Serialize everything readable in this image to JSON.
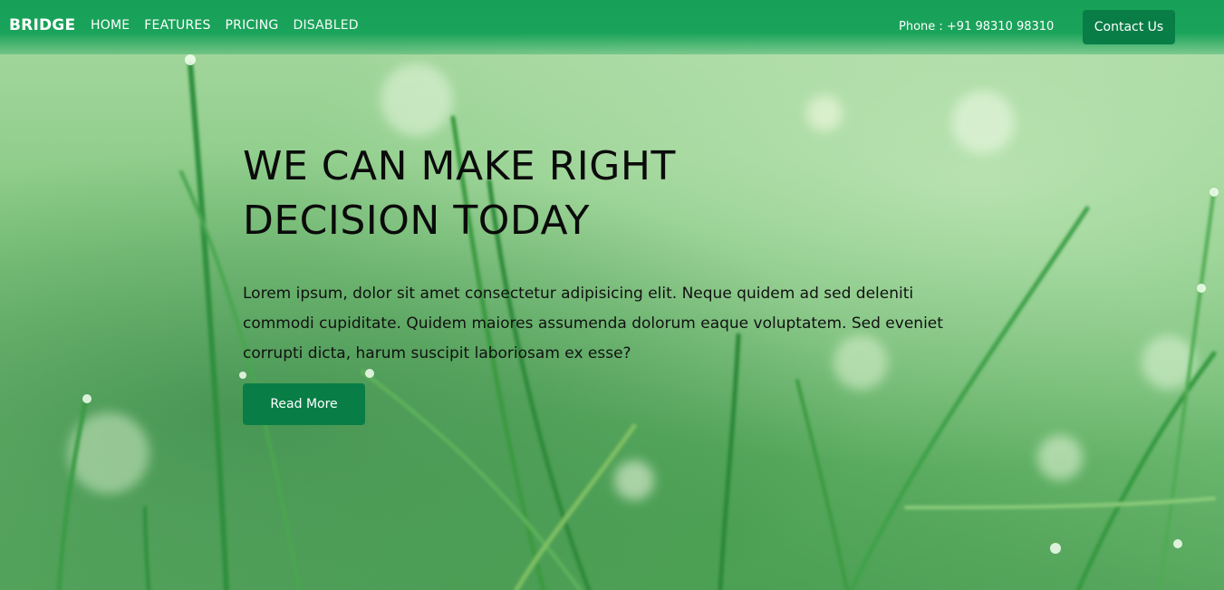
{
  "navbar": {
    "brand": "BRIDGE",
    "links": [
      "HOME",
      "FEATURES",
      "PRICING",
      "DISABLED"
    ],
    "phone": "Phone : +91 98310 98310",
    "contact_label": "Contact Us"
  },
  "hero": {
    "title": "WE CAN MAKE RIGHT DECISION TODAY",
    "text": "Lorem ipsum, dolor sit amet consectetur adipisicing elit. Neque quidem ad sed deleniti commodi cupiditate. Quidem maiores assumenda dolorum eaque voluptatem. Sed eveniet corrupti dicta, harum suscipit laboriosam ex esse?",
    "button_label": "Read More"
  },
  "colors": {
    "navbar": "#1aa35a",
    "button": "#087d46",
    "text_dark": "#0b0b0b"
  }
}
